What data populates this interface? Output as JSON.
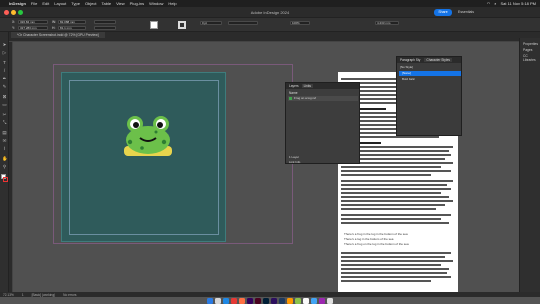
{
  "menubar": {
    "app": "InDesign",
    "items": [
      "File",
      "Edit",
      "Layout",
      "Type",
      "Object",
      "Table",
      "View",
      "Plug-ins",
      "Window",
      "Help"
    ],
    "clock": "Sat 11 Nov  5:18 PM"
  },
  "window": {
    "title": "Adobe InDesign 2024",
    "share_label": "Share",
    "workspace": "Essentials"
  },
  "controlbar": {
    "x": "326.84 mm",
    "y": "327.283 mm",
    "w": "82.088 mm",
    "h": "81.1 mm",
    "stroke": "0 pt",
    "zoom_pct": "100%",
    "ref_size": "4.233 mm"
  },
  "document": {
    "tab_label": "*Or Character Screenshot.indd @ 72% [GPU Preview]"
  },
  "status": {
    "zoom": "72.13%",
    "page": "1",
    "profile": "[Basic] (working)",
    "errors": "No errors"
  },
  "right_panel": {
    "items": [
      "Properties",
      "Pages",
      "CC Libraries"
    ]
  },
  "layers_panel": {
    "tabs": [
      "Layers",
      "Links"
    ],
    "name_col": "Name",
    "rows": [
      "Frog on a log ref"
    ],
    "footer_count": "1 Layer",
    "link_info": "Link Info"
  },
  "styles_panel": {
    "tabs": [
      "Paragraph Sty",
      "Character Styles"
    ],
    "section": "[No Style]",
    "rows": [
      "[None]",
      "Bold Italic"
    ]
  },
  "text_page": {
    "bullets": [
      "There's a frog in the log in the bottom of the sea",
      "There's a log in the bottom of the sea",
      "There's a frog on the log in the bottom of the sea"
    ]
  },
  "colors": {
    "accent": "#1473e6",
    "page_fill": "#2f5b5b",
    "frog_green": "#6cc04a",
    "frog_dark": "#2e7d32",
    "log": "#e8d44d"
  },
  "icons": [
    "apple-icon",
    "wifi-icon",
    "search-icon",
    "selection-tool-icon",
    "text-tool-icon",
    "pen-tool-icon",
    "rectangle-tool-icon",
    "hand-tool-icon",
    "zoom-tool-icon"
  ]
}
